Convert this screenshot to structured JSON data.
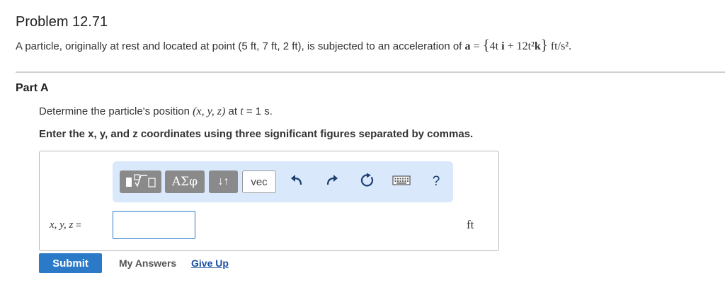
{
  "problem": {
    "title": "Problem 12.71",
    "statement_prefix": "A particle, originally at rest and located at point (5 ft, 7 ft, 2 ft), is subjected to an acceleration of",
    "accel_expr": "a = {4t i + 12t² k} ft/s².",
    "accel_parts": {
      "a": "a",
      "eq": "=",
      "brace_open": "{",
      "term1": "4t",
      "i": "i",
      "plus": "+",
      "term2": "12t²",
      "k": "k",
      "brace_close": "}",
      "units": "ft/s².",
      "point_text": "(5 ft, 7 ft, 2 ft)"
    }
  },
  "part": {
    "title": "Part A",
    "question_prefix": "Determine the particle's position",
    "question_vars": "(x, y, z)",
    "question_at": "at",
    "question_t": "t",
    "question_value": "= 1 s.",
    "instruction": "Enter the x, y, and z coordinates using three significant figures separated by commas."
  },
  "toolbar": {
    "templates_icon": "templates-icon",
    "greek_label": "ΑΣφ",
    "arrows_label": "↓↑",
    "vec_label": "vec",
    "undo_icon": "undo-icon",
    "redo_icon": "redo-icon",
    "reset_icon": "reset-icon",
    "keyboard_icon": "keyboard-icon",
    "help_label": "?"
  },
  "answer": {
    "label": "x, y, z",
    "label_eq": "=",
    "value": "",
    "unit": "ft"
  },
  "actions": {
    "submit_label": "Submit",
    "my_answers_label": "My Answers",
    "give_up_label": "Give Up"
  },
  "colors": {
    "accent": "#2a7ac8",
    "toolbar_bg": "#d9e8fb",
    "toolbar_button": "#8a8a8a",
    "link": "#1a4fa0"
  }
}
